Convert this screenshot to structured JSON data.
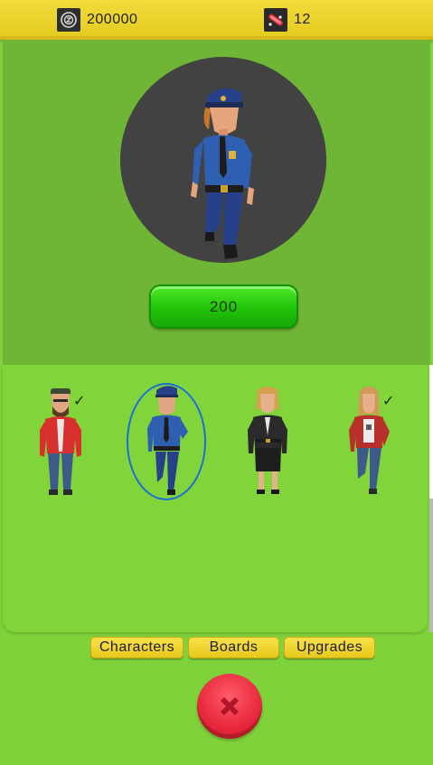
{
  "topbar": {
    "coins": {
      "icon": "coin-icon",
      "value": "200000"
    },
    "boards": {
      "icon": "skateboard-icon",
      "value": "12"
    }
  },
  "preview": {
    "character": "police-officer",
    "price_label": "200"
  },
  "characters": [
    {
      "name": "red-jacket-guy",
      "owned": true,
      "selected": false
    },
    {
      "name": "police-officer",
      "owned": false,
      "selected": true
    },
    {
      "name": "business-woman",
      "owned": false,
      "selected": false
    },
    {
      "name": "red-jacket-girl",
      "owned": true,
      "selected": false
    }
  ],
  "tabs": {
    "characters": "Characters",
    "boards": "Boards",
    "upgrades": "Upgrades"
  },
  "colors": {
    "topbar": "#e9d02a",
    "preview_bg": "#6fb536",
    "list_bg": "#81d53a",
    "buy_button": "#20c308",
    "close_button": "#e8283c",
    "selection_ring": "#1a6fd8"
  },
  "check_mark": "✓"
}
